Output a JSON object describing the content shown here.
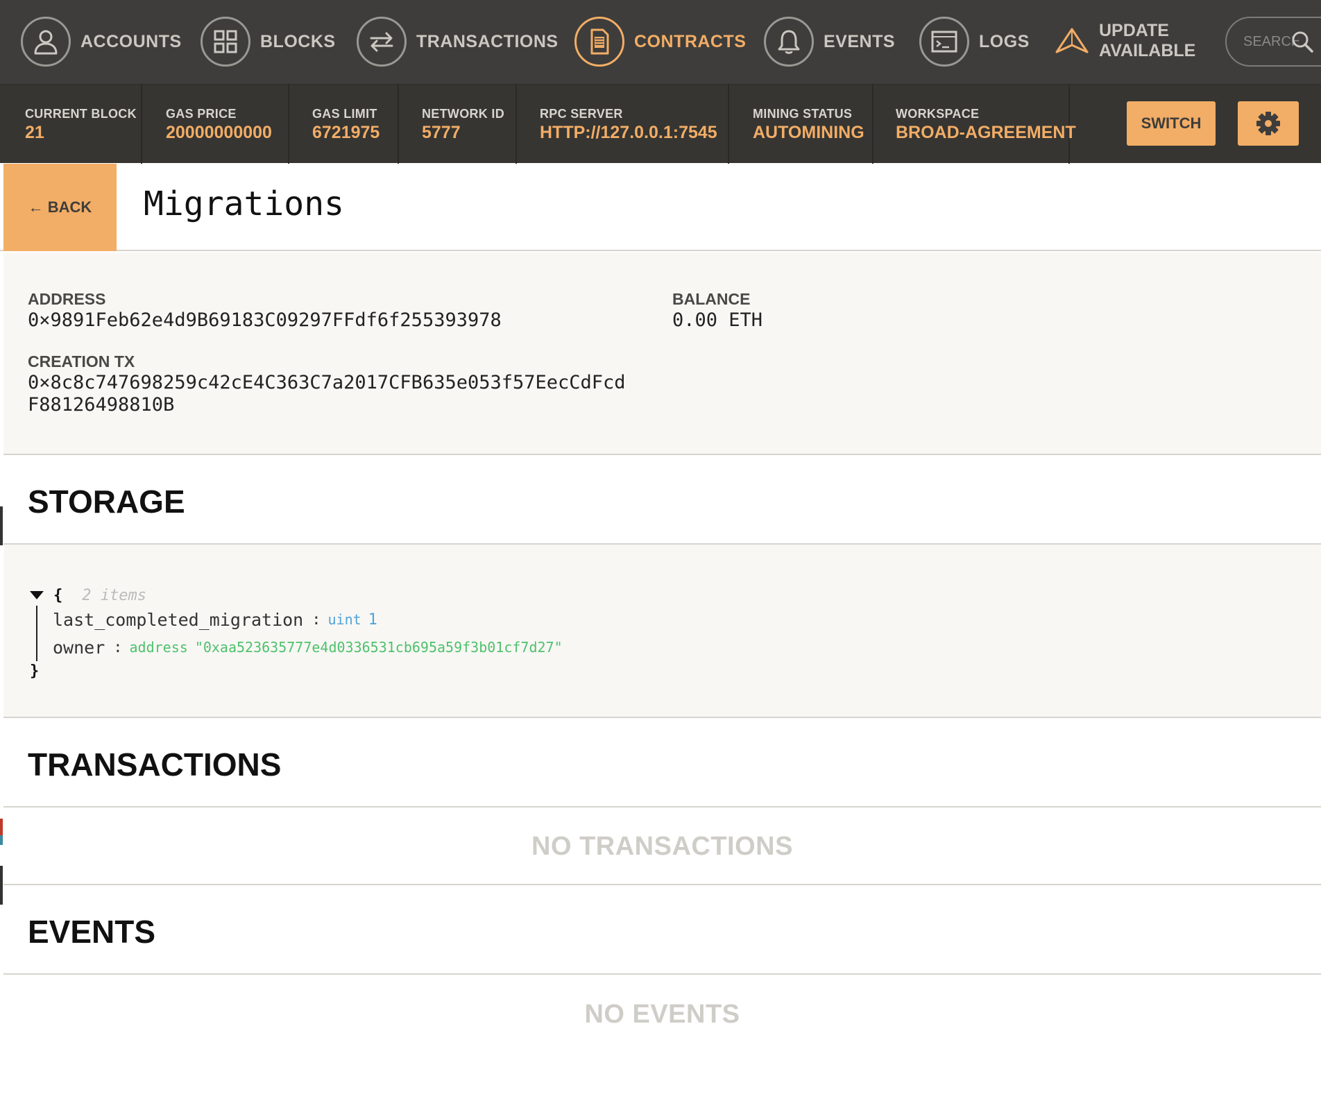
{
  "nav": {
    "items": [
      {
        "label": "ACCOUNTS",
        "icon": "user-icon"
      },
      {
        "label": "BLOCKS",
        "icon": "blocks-icon"
      },
      {
        "label": "TRANSACTIONS",
        "icon": "transfer-icon"
      },
      {
        "label": "CONTRACTS",
        "icon": "document-icon",
        "active": true
      },
      {
        "label": "EVENTS",
        "icon": "bell-icon"
      },
      {
        "label": "LOGS",
        "icon": "terminal-icon"
      }
    ],
    "update": {
      "line1": "UPDATE",
      "line2": "AVAILABLE"
    },
    "search_placeholder": "SEARCH"
  },
  "status": {
    "current_block": {
      "label": "CURRENT BLOCK",
      "value": "21"
    },
    "gas_price": {
      "label": "GAS PRICE",
      "value": "20000000000"
    },
    "gas_limit": {
      "label": "GAS LIMIT",
      "value": "6721975"
    },
    "network_id": {
      "label": "NETWORK ID",
      "value": "5777"
    },
    "rpc_server": {
      "label": "RPC SERVER",
      "value": "HTTP://127.0.0.1:7545"
    },
    "mining_status": {
      "label": "MINING STATUS",
      "value": "AUTOMINING"
    },
    "workspace": {
      "label": "WORKSPACE",
      "value": "BROAD-AGREEMENT"
    },
    "switch_label": "SWITCH"
  },
  "contract": {
    "back_label": "← BACK",
    "title": "Migrations",
    "address_label": "ADDRESS",
    "address": "0×9891Feb62e4d9B69183C09297FFdf6f255393978",
    "balance_label": "BALANCE",
    "balance": "0.00 ETH",
    "creation_tx_label": "CREATION TX",
    "creation_tx_line1": "0×8c8c747698259c42cE4C363C7a2017CFB635e053f57EecCdFcd",
    "creation_tx_line2": "F88126498810B"
  },
  "storage": {
    "heading": "STORAGE",
    "open_brace": "{",
    "close_brace": "}",
    "count": "2 items",
    "rows": [
      {
        "key": "last_completed_migration",
        "type": "uint",
        "value": "1"
      },
      {
        "key": "owner",
        "type": "address",
        "value": "\"0xaa523635777e4d0336531cb695a59f3b01cf7d27\""
      }
    ]
  },
  "transactions": {
    "heading": "TRANSACTIONS",
    "empty": "NO TRANSACTIONS"
  },
  "events": {
    "heading": "EVENTS",
    "empty": "NO EVENTS"
  },
  "colors": {
    "accent": "#f2ad66",
    "nav_bg": "#3e3d3b",
    "status_bg": "#363532"
  }
}
